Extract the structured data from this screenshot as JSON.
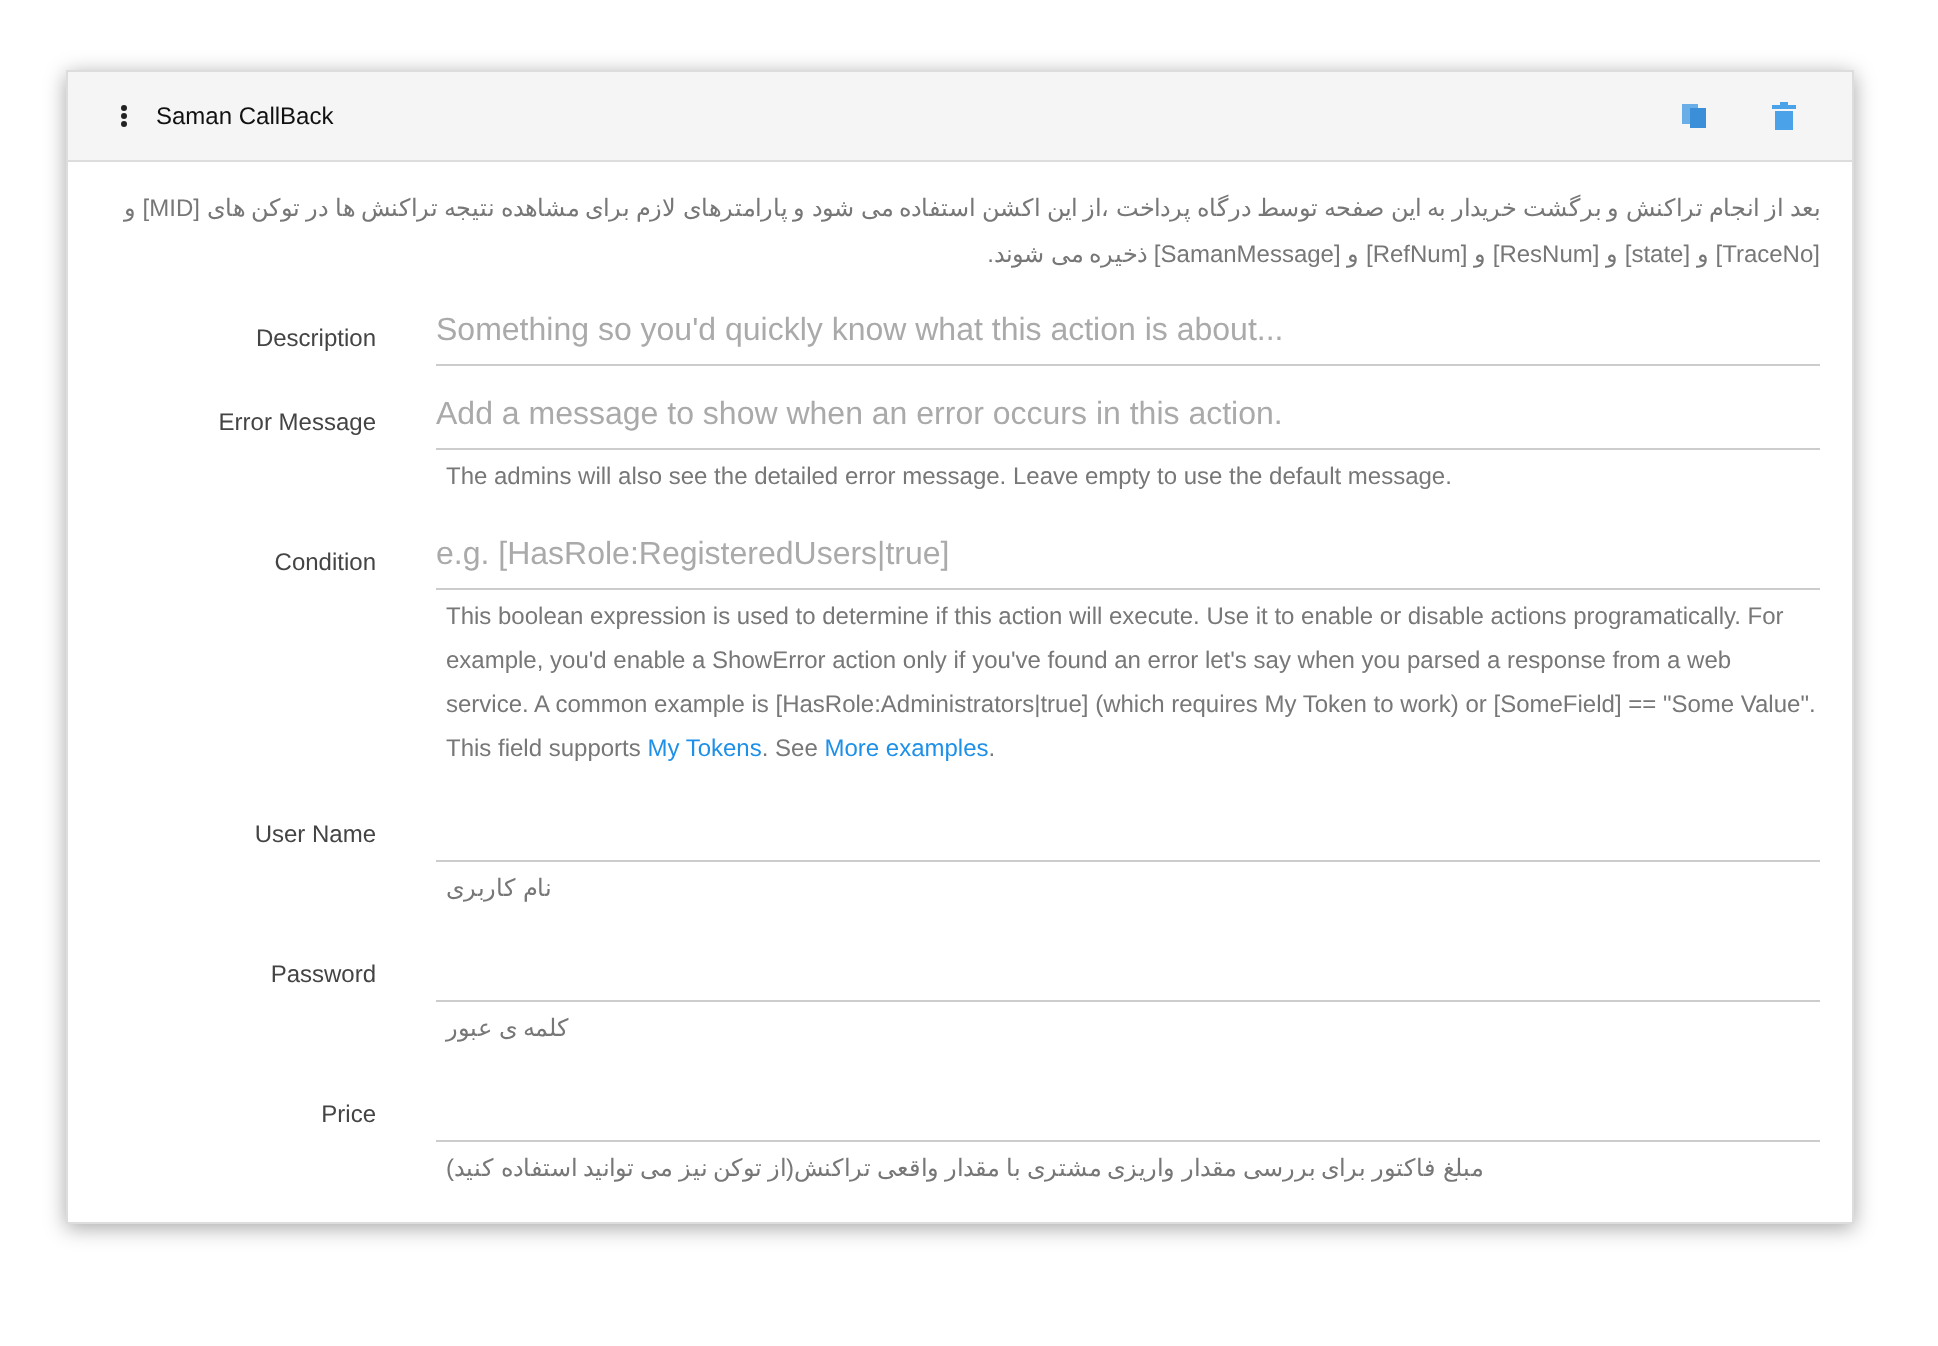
{
  "panel": {
    "title": "Saman CallBack",
    "intro": "بعد از انجام تراکنش و برگشت خریدار به این صفحه توسط درگاه پرداخت ،از این اکشن استفاده می شود و پارامترهای لازم برای مشاهده نتیجه تراکنش ها در توکن های [MID] و [TraceNo] و [state] و [ResNum] و [RefNum] و [SamanMessage] ذخیره می شوند."
  },
  "fields": [
    {
      "label": "Description",
      "placeholder": "Something so you'd quickly know what this action is about..."
    },
    {
      "label": "Error Message",
      "placeholder": "Add a message to show when an error occurs in this action.",
      "help": [
        {
          "kind": "text",
          "text": "The admins will also see the detailed error message. Leave empty to use the default message."
        }
      ]
    },
    {
      "label": "Condition",
      "placeholder": "e.g. [HasRole:RegisteredUsers|true]",
      "help": [
        {
          "kind": "text",
          "text": "This boolean expression is used to determine if this action will execute. Use it to enable or disable actions programatically. For example, you'd enable a ShowError action only if you've found an error let's say when you parsed a response from a web service. A common example is [HasRole:Administrators|true] (which requires My Token to work) or [SomeField] == \"Some Value\". This field supports "
        },
        {
          "kind": "link",
          "text": "My Tokens"
        },
        {
          "kind": "text",
          "text": ". See "
        },
        {
          "kind": "link",
          "text": "More examples"
        },
        {
          "kind": "text",
          "text": "."
        }
      ]
    },
    {
      "label": "User Name",
      "help": [
        {
          "kind": "text",
          "text": "نام کاربری"
        }
      ]
    },
    {
      "label": "Password",
      "help": [
        {
          "kind": "text",
          "text": "کلمه ی عبور"
        }
      ]
    },
    {
      "label": "Price",
      "help": [
        {
          "kind": "text",
          "text": "مبلغ فاکتور برای بررسی مقدار واریزی مشتری با مقدار واقعی تراکنش(از توکن نیز می توانید استفاده کنید)"
        }
      ]
    }
  ]
}
